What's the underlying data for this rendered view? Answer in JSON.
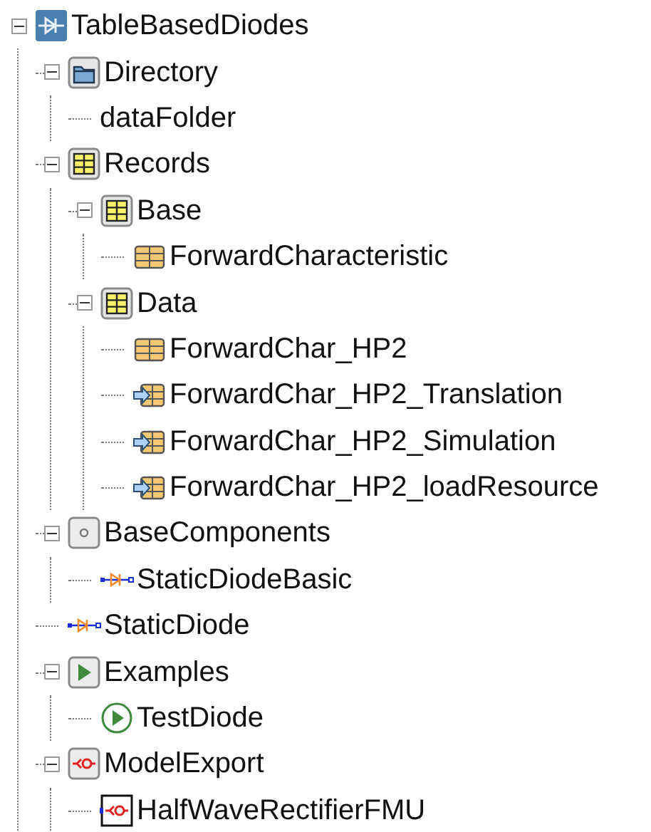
{
  "tree": [
    {
      "label": "TableBasedDiodes",
      "kind": "diode-package",
      "expanded": true,
      "children": [
        {
          "label": "Directory",
          "kind": "folder",
          "expanded": true,
          "children": [
            {
              "label": "dataFolder",
              "kind": "plain"
            }
          ]
        },
        {
          "label": "Records",
          "kind": "record-package",
          "expanded": true,
          "children": [
            {
              "label": "Base",
              "kind": "record-package",
              "expanded": true,
              "children": [
                {
                  "label": "ForwardCharacteristic",
                  "kind": "record"
                }
              ]
            },
            {
              "label": "Data",
              "kind": "record-package",
              "expanded": true,
              "children": [
                {
                  "label": "ForwardChar_HP2",
                  "kind": "record"
                },
                {
                  "label": "ForwardChar_HP2_Translation",
                  "kind": "record-arrow"
                },
                {
                  "label": "ForwardChar_HP2_Simulation",
                  "kind": "record-arrow"
                },
                {
                  "label": "ForwardChar_HP2_loadResource",
                  "kind": "record-arrow"
                }
              ]
            }
          ]
        },
        {
          "label": "BaseComponents",
          "kind": "base-package",
          "expanded": true,
          "children": [
            {
              "label": "StaticDiodeBasic",
              "kind": "diode"
            }
          ]
        },
        {
          "label": "StaticDiode",
          "kind": "diode"
        },
        {
          "label": "Examples",
          "kind": "example-package",
          "expanded": true,
          "children": [
            {
              "label": "TestDiode",
              "kind": "example"
            }
          ]
        },
        {
          "label": "ModelExport",
          "kind": "export-package",
          "expanded": true,
          "children": [
            {
              "label": "HalfWaveRectifierFMU",
              "kind": "fmu"
            }
          ]
        }
      ]
    }
  ]
}
